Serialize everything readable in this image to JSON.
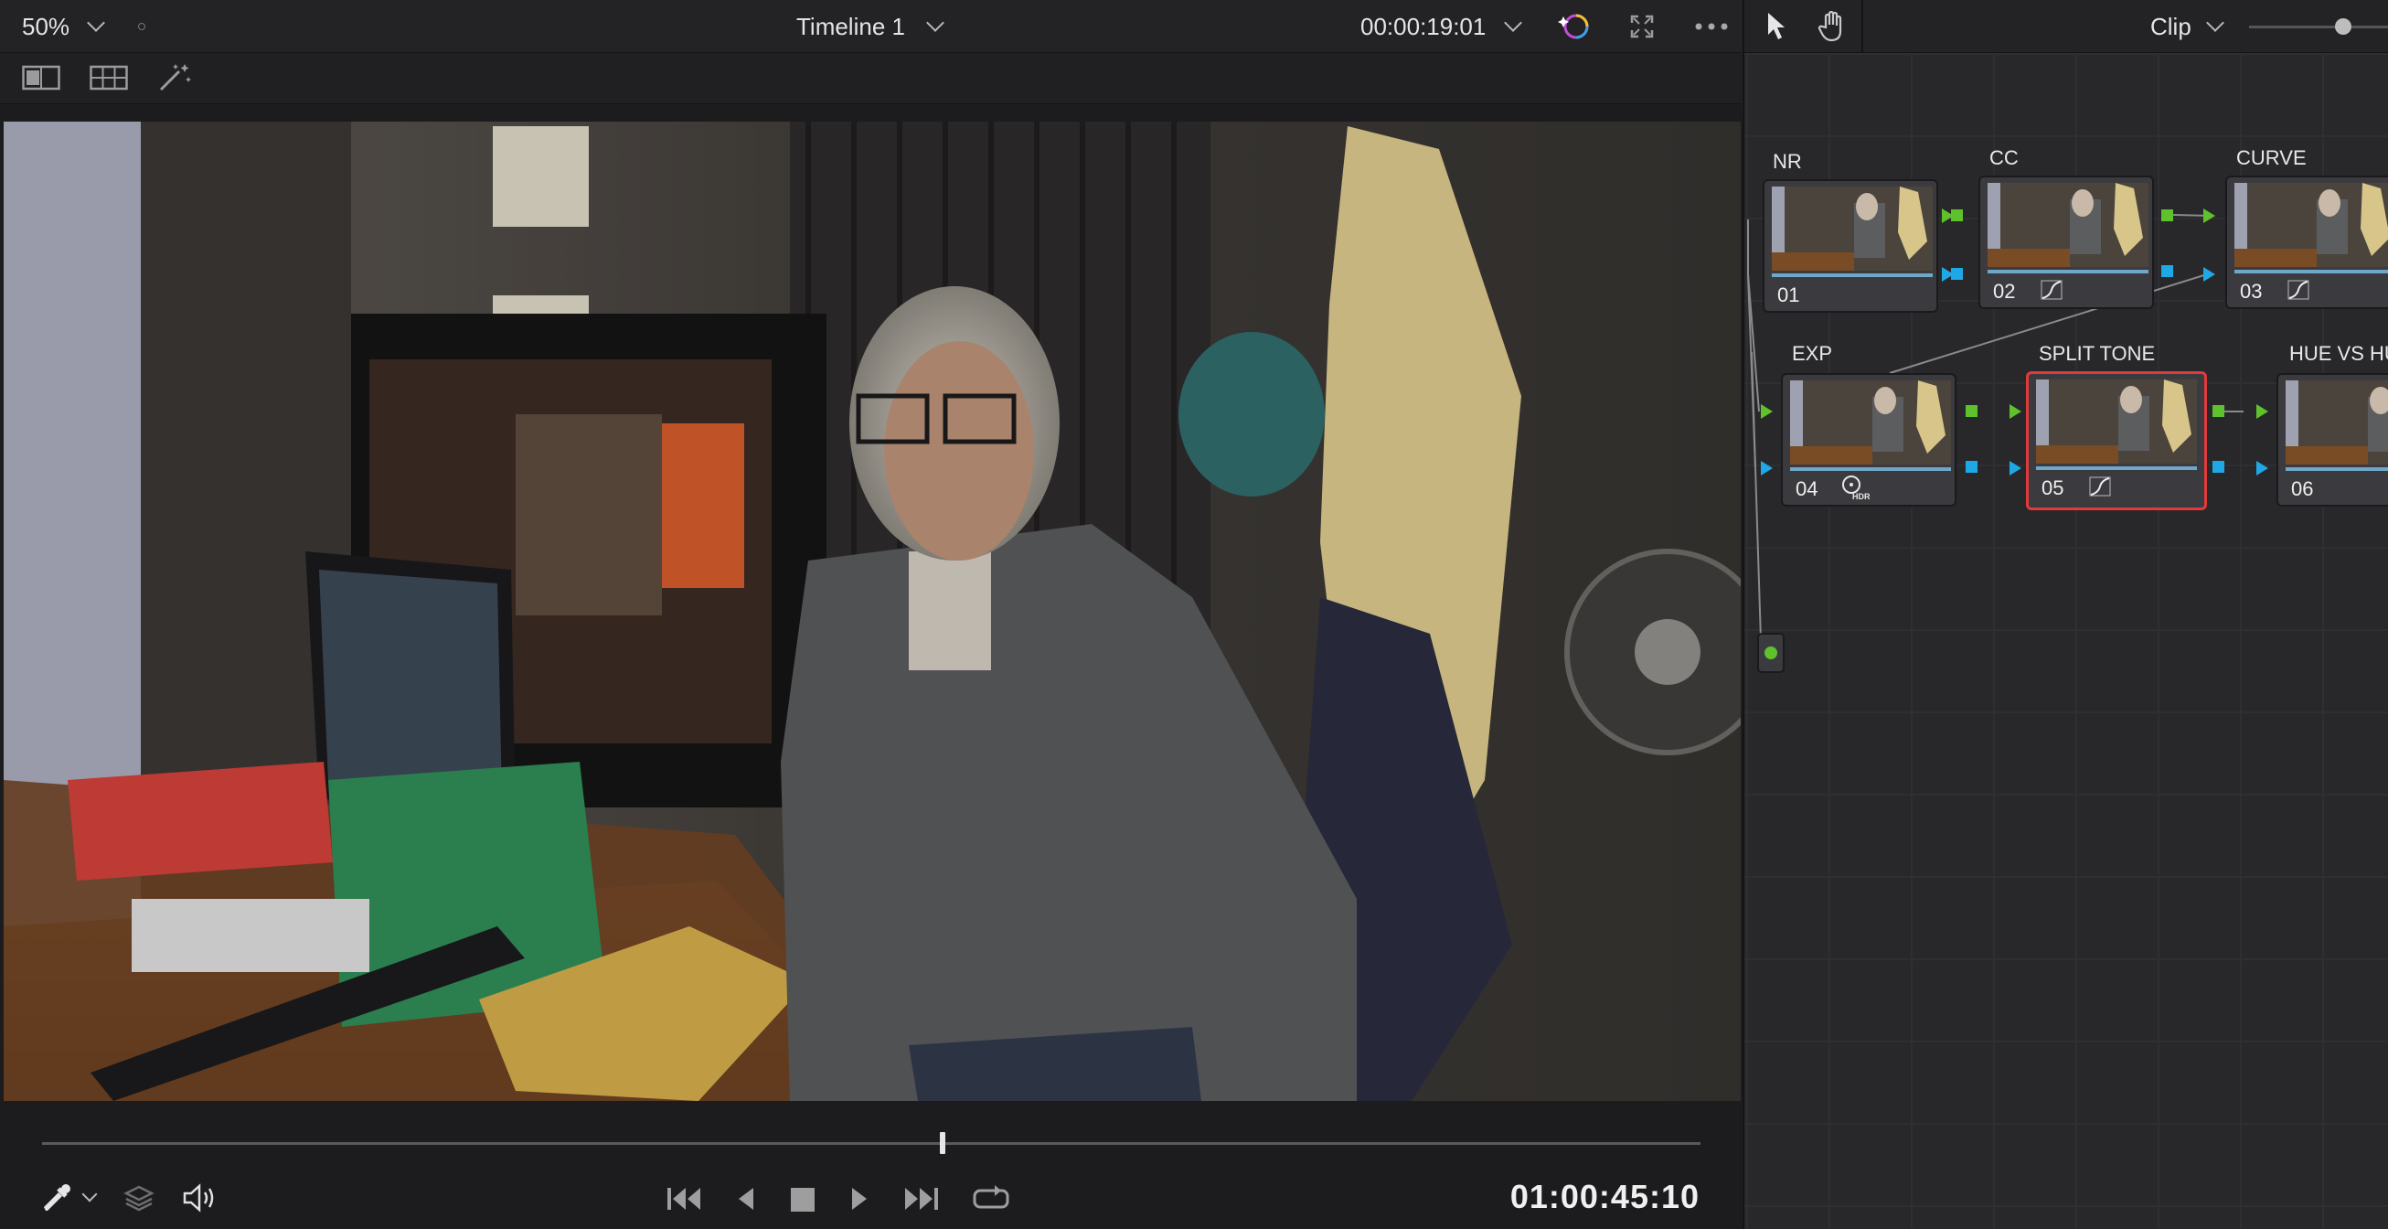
{
  "viewer": {
    "zoom_level": "50%",
    "timeline_name": "Timeline 1",
    "source_timecode": "00:00:19:01",
    "record_timecode": "01:00:45:10",
    "playhead_fraction": 0.543
  },
  "node_editor": {
    "mode_label": "Clip",
    "nodes": [
      {
        "number": "01",
        "label": "NR"
      },
      {
        "number": "02",
        "label": "CC"
      },
      {
        "number": "03",
        "label": "CURVE"
      },
      {
        "number": "04",
        "label": "EXP",
        "badge": "HDR"
      },
      {
        "number": "05",
        "label": "SPLIT TONE"
      },
      {
        "number": "06",
        "label": "HUE VS HU"
      }
    ]
  },
  "colors": {
    "node_selected_border": "#e03a3a",
    "rgb_port": "#5fc12c",
    "alpha_port": "#1ea9e6"
  }
}
